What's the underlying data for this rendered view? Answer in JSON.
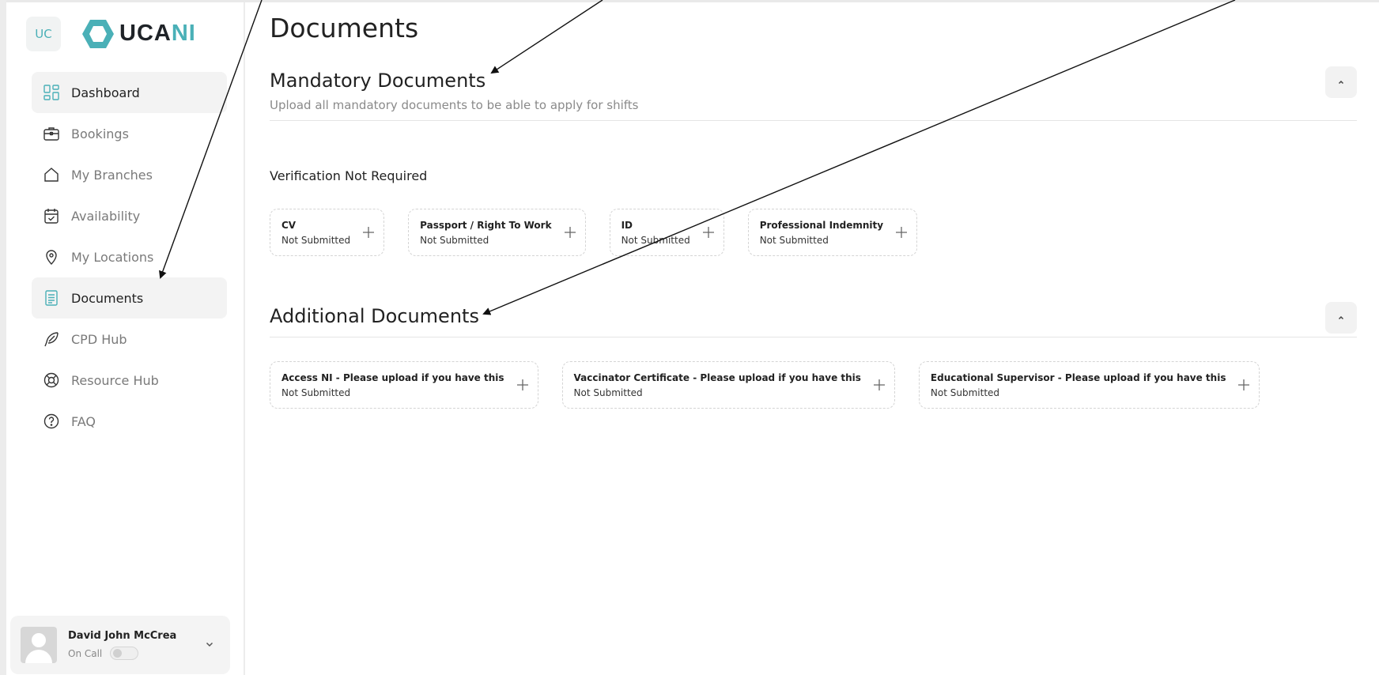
{
  "brand": {
    "badge": "UC",
    "logo_dark": "UCA",
    "logo_teal": "NI",
    "accent": "#4ab0b7"
  },
  "sidebar": {
    "items": [
      {
        "label": "Dashboard",
        "icon": "dashboard-grid-icon"
      },
      {
        "label": "Bookings",
        "icon": "briefcase-icon"
      },
      {
        "label": "My Branches",
        "icon": "home-icon"
      },
      {
        "label": "Availability",
        "icon": "calendar-check-icon"
      },
      {
        "label": "My Locations",
        "icon": "location-pin-icon"
      },
      {
        "label": "Documents",
        "icon": "document-icon"
      },
      {
        "label": "CPD Hub",
        "icon": "feather-icon"
      },
      {
        "label": "Resource Hub",
        "icon": "lifebuoy-icon"
      },
      {
        "label": "FAQ",
        "icon": "help-circle-icon"
      }
    ]
  },
  "user": {
    "name": "David John McCrea",
    "status_label": "On Call",
    "on_call": false
  },
  "page": {
    "title": "Documents"
  },
  "mandatory": {
    "title": "Mandatory Documents",
    "subtitle": "Upload all mandatory documents to be able to apply for shifts",
    "group_label": "Verification Not Required",
    "documents": [
      {
        "name": "CV",
        "status": "Not Submitted"
      },
      {
        "name": "Passport / Right To Work",
        "status": "Not Submitted"
      },
      {
        "name": "ID",
        "status": "Not Submitted"
      },
      {
        "name": "Professional Indemnity",
        "status": "Not Submitted"
      }
    ]
  },
  "additional": {
    "title": "Additional Documents",
    "documents": [
      {
        "name": "Access NI - Please upload if you have this",
        "status": "Not Submitted"
      },
      {
        "name": "Vaccinator Certificate - Please upload if you have this",
        "status": "Not Submitted"
      },
      {
        "name": "Educational Supervisor - Please upload if you have this",
        "status": "Not Submitted"
      }
    ]
  }
}
